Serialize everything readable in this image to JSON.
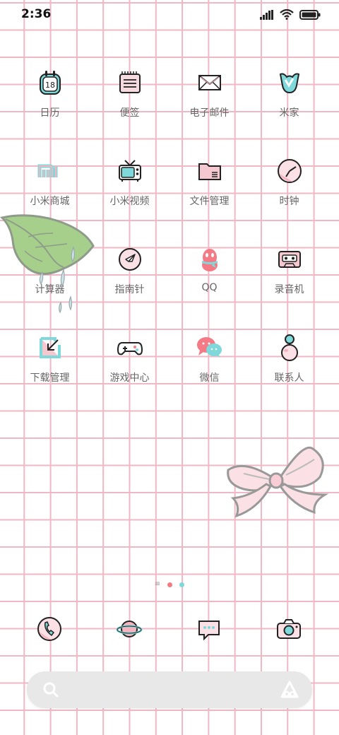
{
  "status": {
    "time": "2:36"
  },
  "apps": [
    {
      "label": "日历",
      "calendar_day": "18"
    },
    {
      "label": "便签"
    },
    {
      "label": "电子邮件"
    },
    {
      "label": "米家"
    },
    {
      "label": "小米商城"
    },
    {
      "label": "小米视频"
    },
    {
      "label": "文件管理"
    },
    {
      "label": "时钟"
    },
    {
      "label": "计算器"
    },
    {
      "label": "指南针"
    },
    {
      "label": "QQ"
    },
    {
      "label": "录音机"
    },
    {
      "label": "下载管理"
    },
    {
      "label": "游戏中心"
    },
    {
      "label": "微信"
    },
    {
      "label": "联系人"
    }
  ],
  "page_indicator": {
    "pages": 2,
    "current": 1
  },
  "dock": [
    "phone-icon",
    "browser-planet-icon",
    "messages-icon",
    "camera-icon"
  ],
  "colors": {
    "grid": "#f0b8c4",
    "pink": "#f5b3bf",
    "teal": "#7fd8d9",
    "outline": "#222222"
  }
}
